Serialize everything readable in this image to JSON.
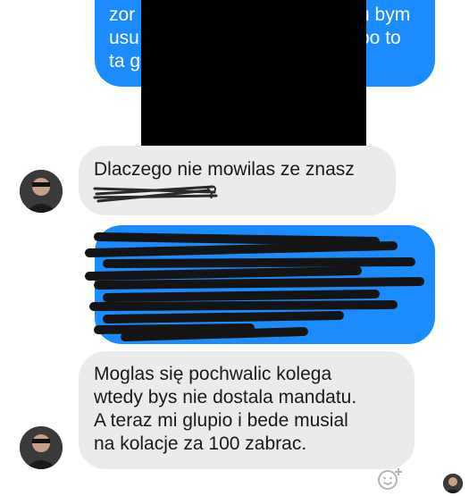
{
  "conversation": {
    "outgoing_top": {
      "lines": [
        "zor",
        "usu",
        "ta g"
      ],
      "right_lines": [
        "u bym",
        "po to"
      ]
    },
    "incoming_1": {
      "lines": [
        "Dlaczego nie mowilas ze znasz",
        "?"
      ]
    },
    "outgoing_middle": {
      "lines": [
        "",
        "",
        "",
        ""
      ]
    },
    "incoming_2": {
      "lines": [
        "Moglas się pochwalic kolega",
        "wtedy bys nie dostala mandatu.",
        "A teraz mi glupio i bede musial",
        "na kolacje za 100 zabrac."
      ]
    }
  },
  "icons": {
    "reaction": "smiley-plus-icon",
    "avatar": "user-avatar",
    "seen": "seen-avatar"
  },
  "colors": {
    "outgoing": "#1a8cff",
    "incoming": "#ebebeb",
    "redaction": "#000000"
  }
}
